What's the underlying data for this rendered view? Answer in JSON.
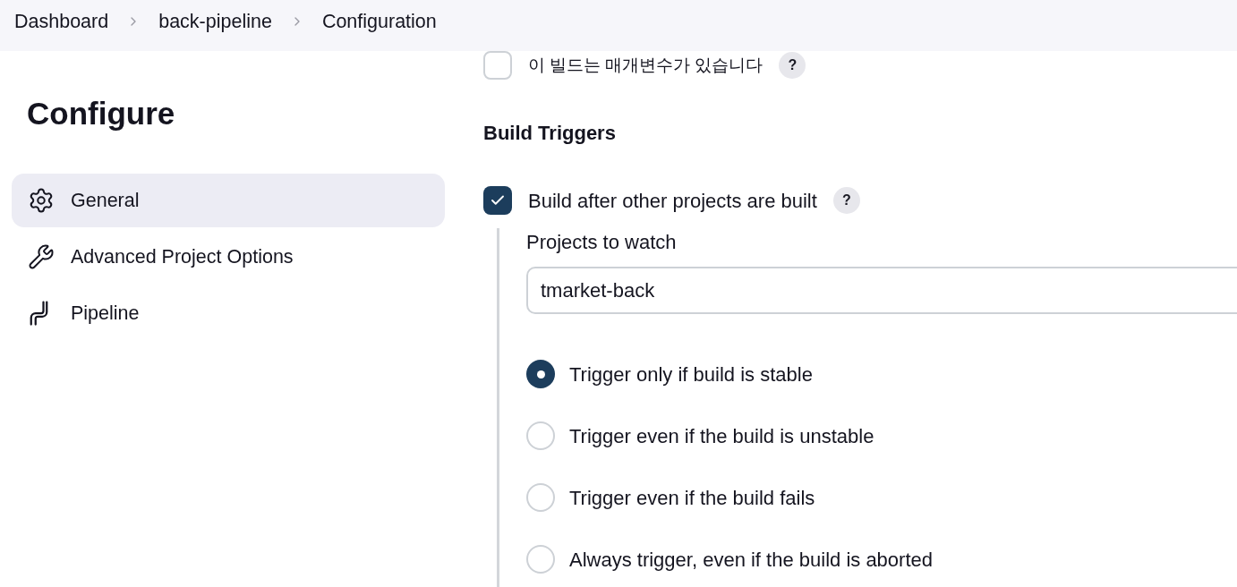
{
  "breadcrumbs": [
    {
      "label": "Dashboard"
    },
    {
      "label": "back-pipeline"
    },
    {
      "label": "Configuration"
    }
  ],
  "sidebar": {
    "title": "Configure",
    "items": [
      {
        "label": "General",
        "selected": true
      },
      {
        "label": "Advanced Project Options",
        "selected": false
      },
      {
        "label": "Pipeline",
        "selected": false
      }
    ]
  },
  "parameters_option": {
    "label": "이 빌드는 매개변수가 있습니다",
    "checked": false,
    "help": "?"
  },
  "build_triggers": {
    "heading": "Build Triggers",
    "option": {
      "label": "Build after other projects are built",
      "checked": true,
      "help": "?"
    },
    "projects_to_watch": {
      "label": "Projects to watch",
      "value": "tmarket-back"
    },
    "radios": [
      {
        "label": "Trigger only if build is stable",
        "selected": true
      },
      {
        "label": "Trigger even if the build is unstable",
        "selected": false
      },
      {
        "label": "Trigger even if the build fails",
        "selected": false
      },
      {
        "label": "Always trigger, even if the build is aborted",
        "selected": false
      }
    ]
  }
}
